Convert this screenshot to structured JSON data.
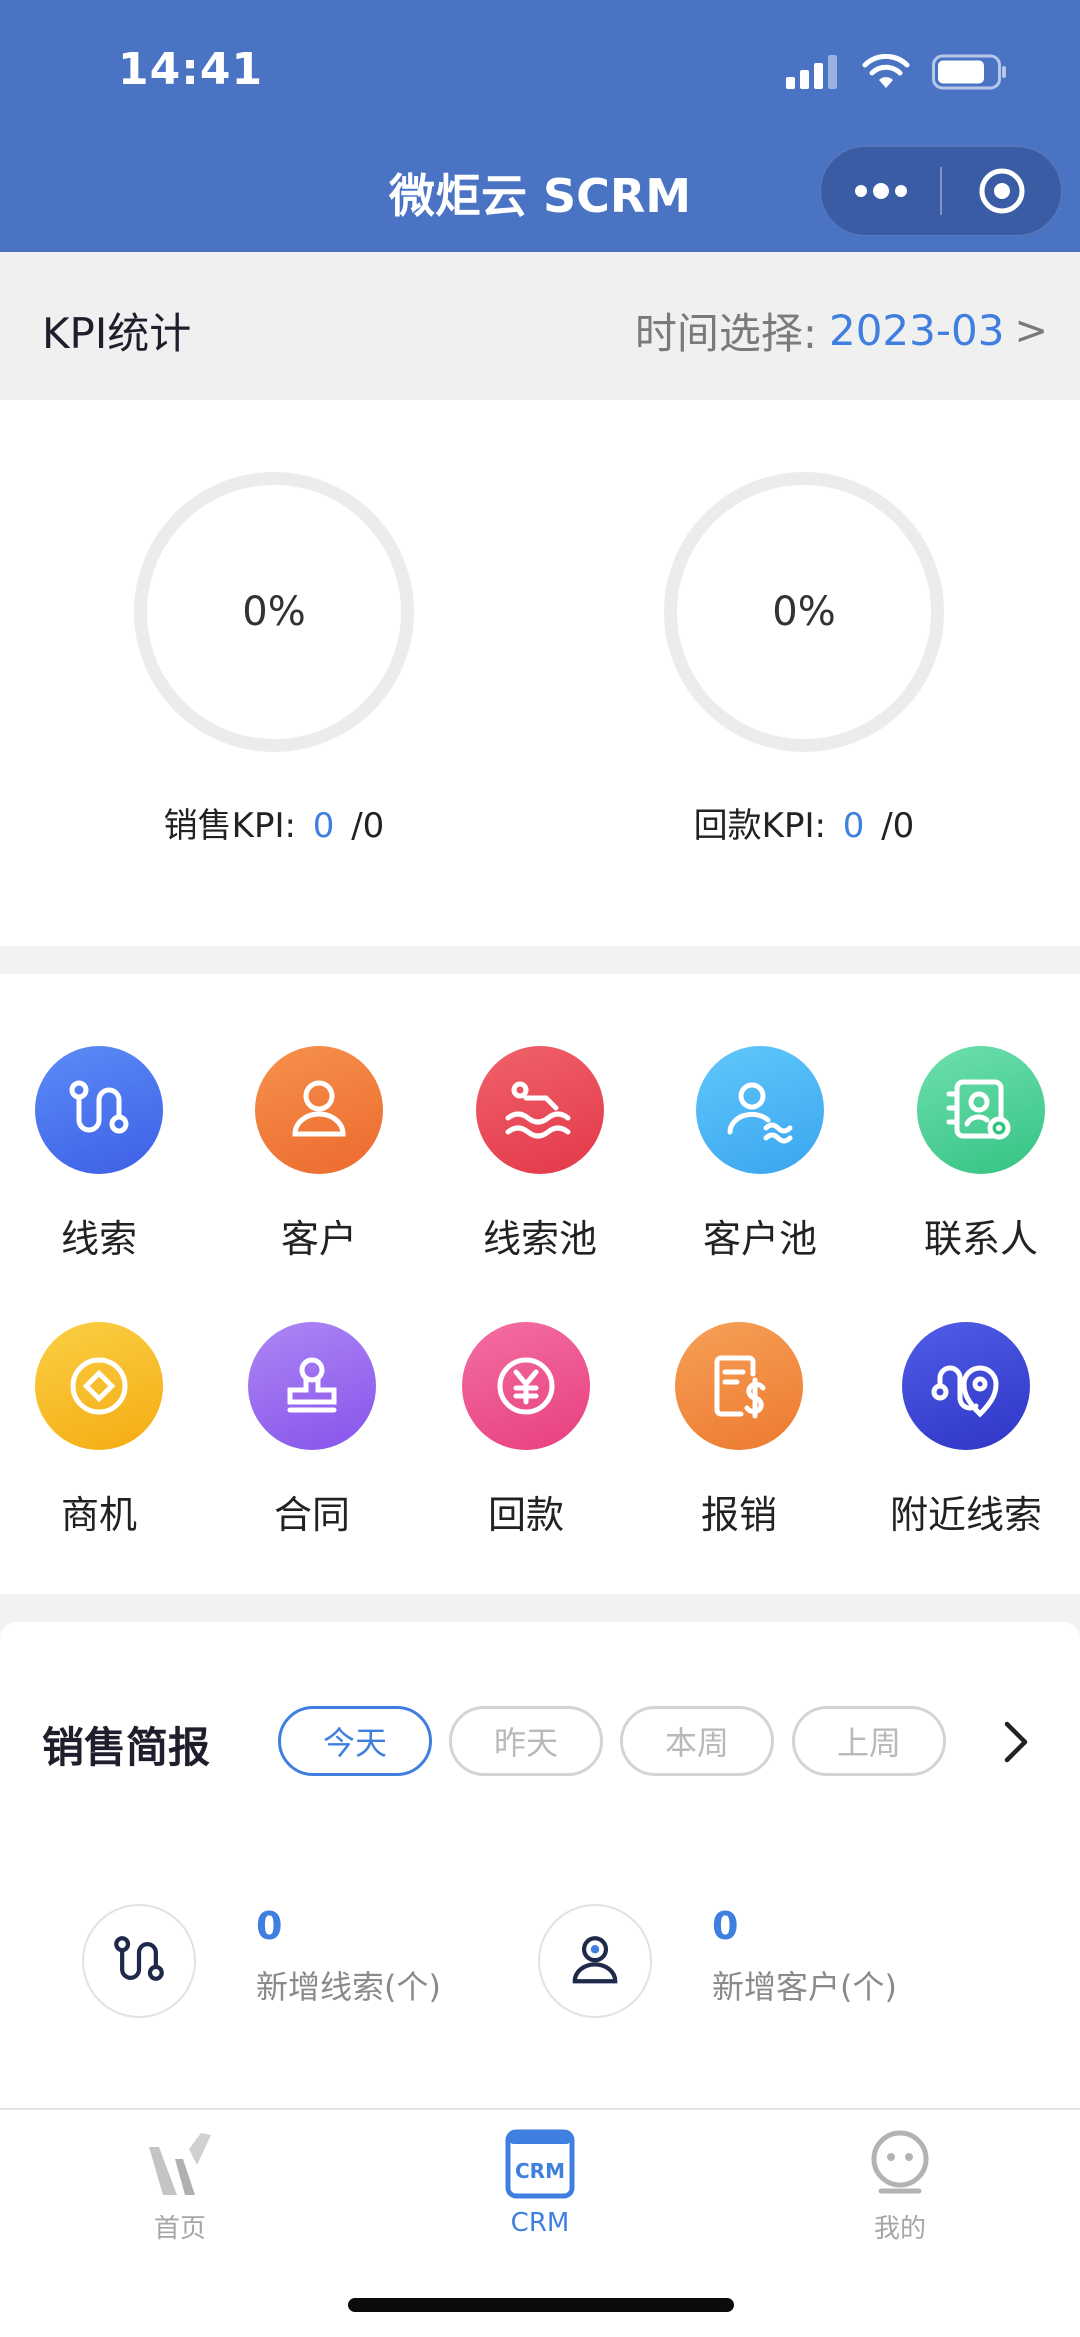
{
  "status_bar": {
    "time": "14:41"
  },
  "nav": {
    "title": "微炬云 SCRM"
  },
  "kpi": {
    "title": "KPI统计",
    "time_label": "时间选择:",
    "time_value": "2023-03",
    "arrow": ">",
    "sales": {
      "percent": "0%",
      "label": "销售KPI:",
      "done": "0",
      "target": "/0"
    },
    "payment": {
      "percent": "0%",
      "label": "回款KPI:",
      "done": "0",
      "target": "/0"
    }
  },
  "grid": {
    "items": [
      {
        "label": "线索"
      },
      {
        "label": "客户"
      },
      {
        "label": "线索池"
      },
      {
        "label": "客户池"
      },
      {
        "label": "联系人"
      },
      {
        "label": "商机"
      },
      {
        "label": "合同"
      },
      {
        "label": "回款"
      },
      {
        "label": "报销"
      },
      {
        "label": "附近线索"
      }
    ]
  },
  "sales_report": {
    "title": "销售简报",
    "chips": [
      "今天",
      "昨天",
      "本周",
      "上周"
    ],
    "active_chip": "今天",
    "stats": [
      {
        "value": "0",
        "label": "新增线索(个)"
      },
      {
        "value": "0",
        "label": "新增客户(个)"
      }
    ]
  },
  "tabbar": {
    "tabs": [
      {
        "label": "首页"
      },
      {
        "label": "CRM"
      },
      {
        "label": "我的"
      }
    ],
    "active": "CRM"
  },
  "colors": {
    "header_bg": "#4a74c3",
    "accent": "#3f7fe0",
    "leads": "#4a6ff0",
    "customers": "#f07c3c",
    "lead_pool": "#ec4b53",
    "customer_pool": "#4cb8f5",
    "contacts": "#4fd39c",
    "opportunities": "#f7b81f",
    "contracts": "#9a6cf0",
    "payments": "#ee5592",
    "expenses": "#f08a3a",
    "nearby_leads": "#3e4ad6"
  }
}
